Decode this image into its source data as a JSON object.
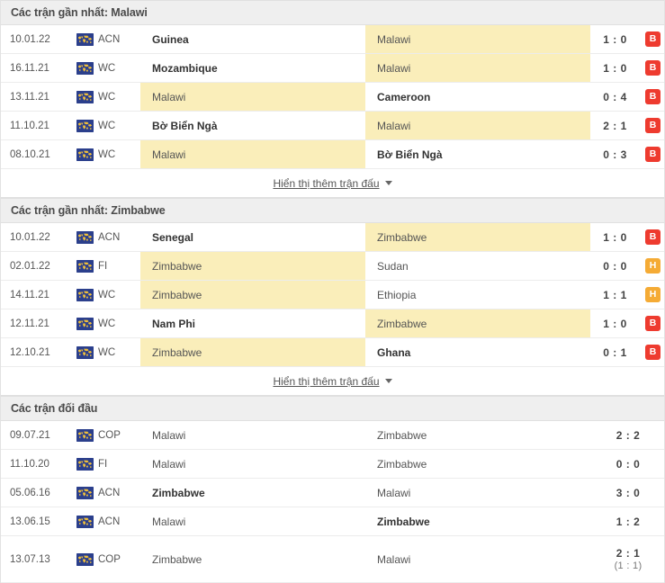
{
  "colors": {
    "highlight": "#faeeba",
    "loss": "#ee3b2f",
    "draw": "#f5ab35",
    "header_bg": "#efefef"
  },
  "show_more_label": "Hiển thị thêm trận đấu",
  "sections": [
    {
      "id": "recent-malawi",
      "title": "Các trận gần nhất: Malawi",
      "has_show_more": true,
      "has_badges": true,
      "rows": [
        {
          "date": "10.01.22",
          "comp": "ACN",
          "flag": "world-flag-icon",
          "home": "Guinea",
          "away": "Malawi",
          "home_hl": false,
          "away_hl": true,
          "home_win": true,
          "away_win": false,
          "score": "1 : 0",
          "sub": "",
          "badge": "B",
          "badge_type": "loss"
        },
        {
          "date": "16.11.21",
          "comp": "WC",
          "flag": "world-flag-icon",
          "home": "Mozambique",
          "away": "Malawi",
          "home_hl": false,
          "away_hl": true,
          "home_win": true,
          "away_win": false,
          "score": "1 : 0",
          "sub": "",
          "badge": "B",
          "badge_type": "loss"
        },
        {
          "date": "13.11.21",
          "comp": "WC",
          "flag": "world-flag-icon",
          "home": "Malawi",
          "away": "Cameroon",
          "home_hl": true,
          "away_hl": false,
          "home_win": false,
          "away_win": true,
          "score": "0 : 4",
          "sub": "",
          "badge": "B",
          "badge_type": "loss"
        },
        {
          "date": "11.10.21",
          "comp": "WC",
          "flag": "world-flag-icon",
          "home": "Bờ Biển Ngà",
          "away": "Malawi",
          "home_hl": false,
          "away_hl": true,
          "home_win": true,
          "away_win": false,
          "score": "2 : 1",
          "sub": "",
          "badge": "B",
          "badge_type": "loss"
        },
        {
          "date": "08.10.21",
          "comp": "WC",
          "flag": "world-flag-icon",
          "home": "Malawi",
          "away": "Bờ Biển Ngà",
          "home_hl": true,
          "away_hl": false,
          "home_win": false,
          "away_win": true,
          "score": "0 : 3",
          "sub": "",
          "badge": "B",
          "badge_type": "loss"
        }
      ]
    },
    {
      "id": "recent-zimbabwe",
      "title": "Các trận gần nhất: Zimbabwe",
      "has_show_more": true,
      "has_badges": true,
      "rows": [
        {
          "date": "10.01.22",
          "comp": "ACN",
          "flag": "world-flag-icon",
          "home": "Senegal",
          "away": "Zimbabwe",
          "home_hl": false,
          "away_hl": true,
          "home_win": true,
          "away_win": false,
          "score": "1 : 0",
          "sub": "",
          "badge": "B",
          "badge_type": "loss"
        },
        {
          "date": "02.01.22",
          "comp": "FI",
          "flag": "world-flag-icon",
          "home": "Zimbabwe",
          "away": "Sudan",
          "home_hl": true,
          "away_hl": false,
          "home_win": false,
          "away_win": false,
          "score": "0 : 0",
          "sub": "",
          "badge": "H",
          "badge_type": "draw"
        },
        {
          "date": "14.11.21",
          "comp": "WC",
          "flag": "world-flag-icon",
          "home": "Zimbabwe",
          "away": "Ethiopia",
          "home_hl": true,
          "away_hl": false,
          "home_win": false,
          "away_win": false,
          "score": "1 : 1",
          "sub": "",
          "badge": "H",
          "badge_type": "draw"
        },
        {
          "date": "12.11.21",
          "comp": "WC",
          "flag": "world-flag-icon",
          "home": "Nam Phi",
          "away": "Zimbabwe",
          "home_hl": false,
          "away_hl": true,
          "home_win": true,
          "away_win": false,
          "score": "1 : 0",
          "sub": "",
          "badge": "B",
          "badge_type": "loss"
        },
        {
          "date": "12.10.21",
          "comp": "WC",
          "flag": "world-flag-icon",
          "home": "Zimbabwe",
          "away": "Ghana",
          "home_hl": true,
          "away_hl": false,
          "home_win": false,
          "away_win": true,
          "score": "0 : 1",
          "sub": "",
          "badge": "B",
          "badge_type": "loss"
        }
      ]
    },
    {
      "id": "head-to-head",
      "title": "Các trận đối đầu",
      "has_show_more": false,
      "has_badges": false,
      "rows": [
        {
          "date": "09.07.21",
          "comp": "COP",
          "flag": "world-flag-icon",
          "home": "Malawi",
          "away": "Zimbabwe",
          "home_hl": false,
          "away_hl": false,
          "home_win": false,
          "away_win": false,
          "score": "2 : 2",
          "sub": "",
          "badge": "",
          "badge_type": ""
        },
        {
          "date": "11.10.20",
          "comp": "FI",
          "flag": "world-flag-icon",
          "home": "Malawi",
          "away": "Zimbabwe",
          "home_hl": false,
          "away_hl": false,
          "home_win": false,
          "away_win": false,
          "score": "0 : 0",
          "sub": "",
          "badge": "",
          "badge_type": ""
        },
        {
          "date": "05.06.16",
          "comp": "ACN",
          "flag": "world-flag-icon",
          "home": "Zimbabwe",
          "away": "Malawi",
          "home_hl": false,
          "away_hl": false,
          "home_win": true,
          "away_win": false,
          "score": "3 : 0",
          "sub": "",
          "badge": "",
          "badge_type": ""
        },
        {
          "date": "13.06.15",
          "comp": "ACN",
          "flag": "world-flag-icon",
          "home": "Malawi",
          "away": "Zimbabwe",
          "home_hl": false,
          "away_hl": false,
          "home_win": false,
          "away_win": true,
          "score": "1 : 2",
          "sub": "",
          "badge": "",
          "badge_type": ""
        },
        {
          "date": "13.07.13",
          "comp": "COP",
          "flag": "world-flag-icon",
          "home": "Zimbabwe",
          "away": "Malawi",
          "home_hl": false,
          "away_hl": false,
          "home_win": false,
          "away_win": false,
          "score": "2 : 1",
          "sub": "(1 : 1)",
          "badge": "",
          "badge_type": ""
        }
      ]
    }
  ]
}
